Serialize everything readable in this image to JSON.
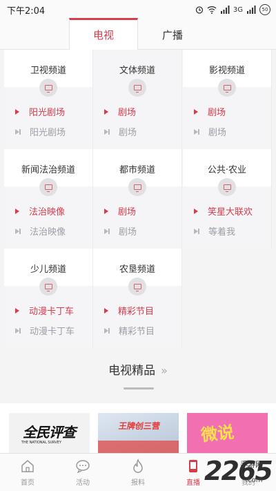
{
  "status_bar": {
    "time": "下午2:04",
    "network": "3G",
    "battery": "50"
  },
  "tabs": [
    {
      "label": "电视"
    },
    {
      "label": "广播"
    }
  ],
  "channels": [
    {
      "name": "卫视频道",
      "now": "阳光剧场",
      "next": "阳光剧场"
    },
    {
      "name": "文体频道",
      "now": "剧场",
      "next": "剧场"
    },
    {
      "name": "影视频道",
      "now": "剧场",
      "next": "剧场"
    },
    {
      "name": "新闻法治频道",
      "now": "法治映像",
      "next": "法治映像"
    },
    {
      "name": "都市频道",
      "now": "剧场",
      "next": "剧场"
    },
    {
      "name": "公共·农业",
      "now": "笑星大联欢",
      "next": "等着我"
    },
    {
      "name": "少儿频道",
      "now": "动漫卡丁车",
      "next": "动漫卡丁车"
    },
    {
      "name": "农垦频道",
      "now": "精彩节目",
      "next": "精彩节目"
    }
  ],
  "premium": {
    "title": "电视精品",
    "more": "»"
  },
  "thumbnails": [
    {
      "title": "全民评查",
      "subtitle": "THE NATIONAL SURVEY"
    },
    {
      "title": "王牌创三营"
    },
    {
      "title": "微说"
    }
  ],
  "bottom_nav": [
    {
      "label": "首页",
      "icon": "home-icon"
    },
    {
      "label": "活动",
      "icon": "chat-bubble-icon"
    },
    {
      "label": "报料",
      "icon": "flame-icon"
    },
    {
      "label": "直播",
      "icon": "live-tv-icon"
    },
    {
      "label": "我的",
      "icon": "user-icon"
    }
  ],
  "watermark": {
    "logo": "2265",
    "dot_suffix": ".com",
    "site": "手游网"
  },
  "colors": {
    "accent": "#d83b4b",
    "muted": "#9a9ea6"
  }
}
